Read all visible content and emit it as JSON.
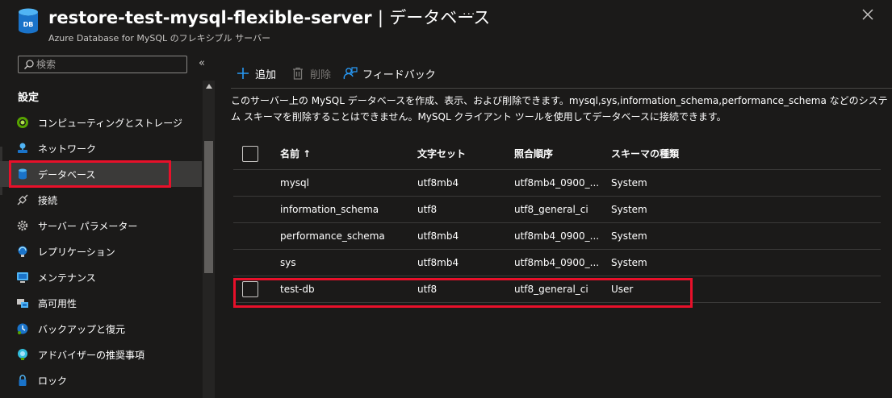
{
  "header": {
    "title_resource": "restore-test-mysql-flexible-server",
    "title_separator": "|",
    "title_page": "データベース",
    "subtitle": "Azure Database for MySQL のフレキシブル サーバー",
    "more": "···",
    "icon_text": "DB"
  },
  "sidebar": {
    "search_placeholder": "検索",
    "collapse": "«",
    "section_title": "設定",
    "items": [
      {
        "label": "コンピューティングとストレージ",
        "icon": "compute-storage-icon"
      },
      {
        "label": "ネットワーク",
        "icon": "network-icon"
      },
      {
        "label": "データベース",
        "icon": "database-icon",
        "active": true
      },
      {
        "label": "接続",
        "icon": "connect-icon"
      },
      {
        "label": "サーバー パラメーター",
        "icon": "gear-icon"
      },
      {
        "label": "レプリケーション",
        "icon": "replication-icon"
      },
      {
        "label": "メンテナンス",
        "icon": "maintenance-icon"
      },
      {
        "label": "高可用性",
        "icon": "high-availability-icon"
      },
      {
        "label": "バックアップと復元",
        "icon": "backup-restore-icon"
      },
      {
        "label": "アドバイザーの推奨事項",
        "icon": "advisor-icon"
      },
      {
        "label": "ロック",
        "icon": "lock-icon"
      }
    ]
  },
  "toolbar": {
    "add": "追加",
    "delete": "削除",
    "feedback": "フィードバック"
  },
  "description": "このサーバー上の MySQL データベースを作成、表示、および削除できます。mysql,sys,information_schema,performance_schema などのシステム スキーマを削除することはできません。MySQL クライアント ツールを使用してデータベースに接続できます。",
  "table": {
    "columns": [
      "名前 ↑",
      "文字セット",
      "照合順序",
      "スキーマの種類"
    ],
    "rows": [
      {
        "name": "mysql",
        "charset": "utf8mb4",
        "collation": "utf8mb4_0900_...",
        "type": "System",
        "selectable": false
      },
      {
        "name": "information_schema",
        "charset": "utf8",
        "collation": "utf8_general_ci",
        "type": "System",
        "selectable": false
      },
      {
        "name": "performance_schema",
        "charset": "utf8mb4",
        "collation": "utf8mb4_0900_...",
        "type": "System",
        "selectable": false
      },
      {
        "name": "sys",
        "charset": "utf8mb4",
        "collation": "utf8mb4_0900_...",
        "type": "System",
        "selectable": false
      },
      {
        "name": "test-db",
        "charset": "utf8",
        "collation": "utf8_general_ci",
        "type": "User",
        "selectable": true
      }
    ]
  },
  "colors": {
    "background": "#1b1a19",
    "accent_blue": "#2899f5",
    "highlight_red": "#e8102a",
    "active_bg": "#3b3a39"
  }
}
